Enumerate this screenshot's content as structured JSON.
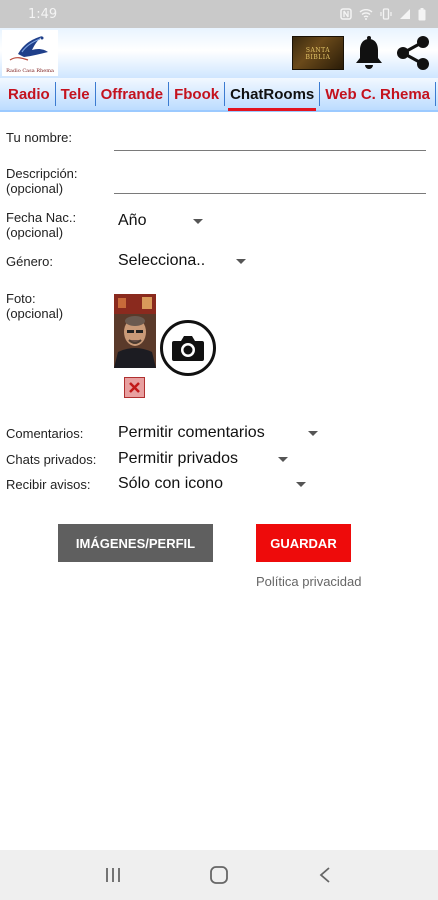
{
  "status": {
    "time": "1:49",
    "icons": [
      "nfc-icon",
      "wifi-icon",
      "vibrate-icon",
      "signal-icon",
      "battery-icon"
    ]
  },
  "header": {
    "logo_text": "Radio Casa Rhema",
    "bible_text": "SANTA BIBLIA",
    "icons": [
      "bell-icon",
      "share-icon"
    ]
  },
  "tabs": [
    {
      "label": "Radio"
    },
    {
      "label": "Tele"
    },
    {
      "label": "Offrande"
    },
    {
      "label": "Fbook"
    },
    {
      "label": "ChatRooms"
    },
    {
      "label": "Web C. Rhema"
    }
  ],
  "active_tab": "ChatRooms",
  "form": {
    "name_label": "Tu nombre:",
    "name_value": "",
    "description_label": "Descripción:",
    "description_optional": "(opcional)",
    "description_value": "",
    "birth_label": "Fecha Nac.:",
    "birth_optional": "(opcional)",
    "birth_value": "Año",
    "gender_label": "Género:",
    "gender_value": "Selecciona..",
    "photo_label": "Foto:",
    "photo_optional": "(opcional)",
    "comments_label": "Comentarios:",
    "comments_value": "Permitir comentarios",
    "private_label": "Chats privados:",
    "private_value": "Permitir privados",
    "notify_label": "Recibir avisos:",
    "notify_value": "Sólo con icono"
  },
  "buttons": {
    "images_label": "IMÁGENES/PERFIL",
    "save_label": "GUARDAR",
    "privacy_label": "Política privacidad"
  },
  "colors": {
    "tab_text": "#c4121e",
    "active_underline": "#e3141f",
    "save_button": "#ee0b0b",
    "images_button": "#5f5f5f"
  }
}
